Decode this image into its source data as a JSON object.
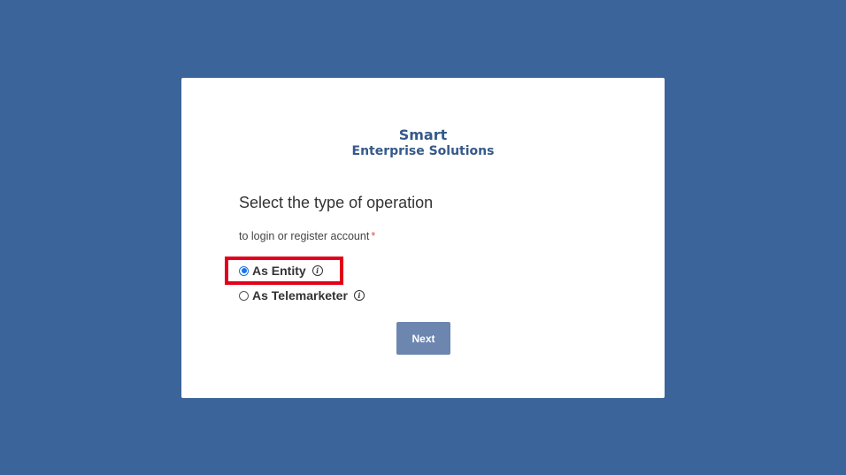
{
  "brand": {
    "line1": "Smart",
    "line2": "Enterprise Solutions"
  },
  "form": {
    "heading": "Select the type of operation",
    "subtext": "to login or register account",
    "required_mark": "*",
    "options": [
      {
        "label": "As Entity",
        "selected": true,
        "icon": "info-icon"
      },
      {
        "label": "As Telemarketer",
        "selected": false,
        "icon": "info-icon"
      }
    ],
    "info_glyph": "i",
    "next_label": "Next"
  },
  "colors": {
    "page_background": "#3b649a",
    "brand_text": "#35598a",
    "button_background": "#6c86b0",
    "highlight_border": "#e2001a",
    "radio_selected": "#1a73e8"
  }
}
